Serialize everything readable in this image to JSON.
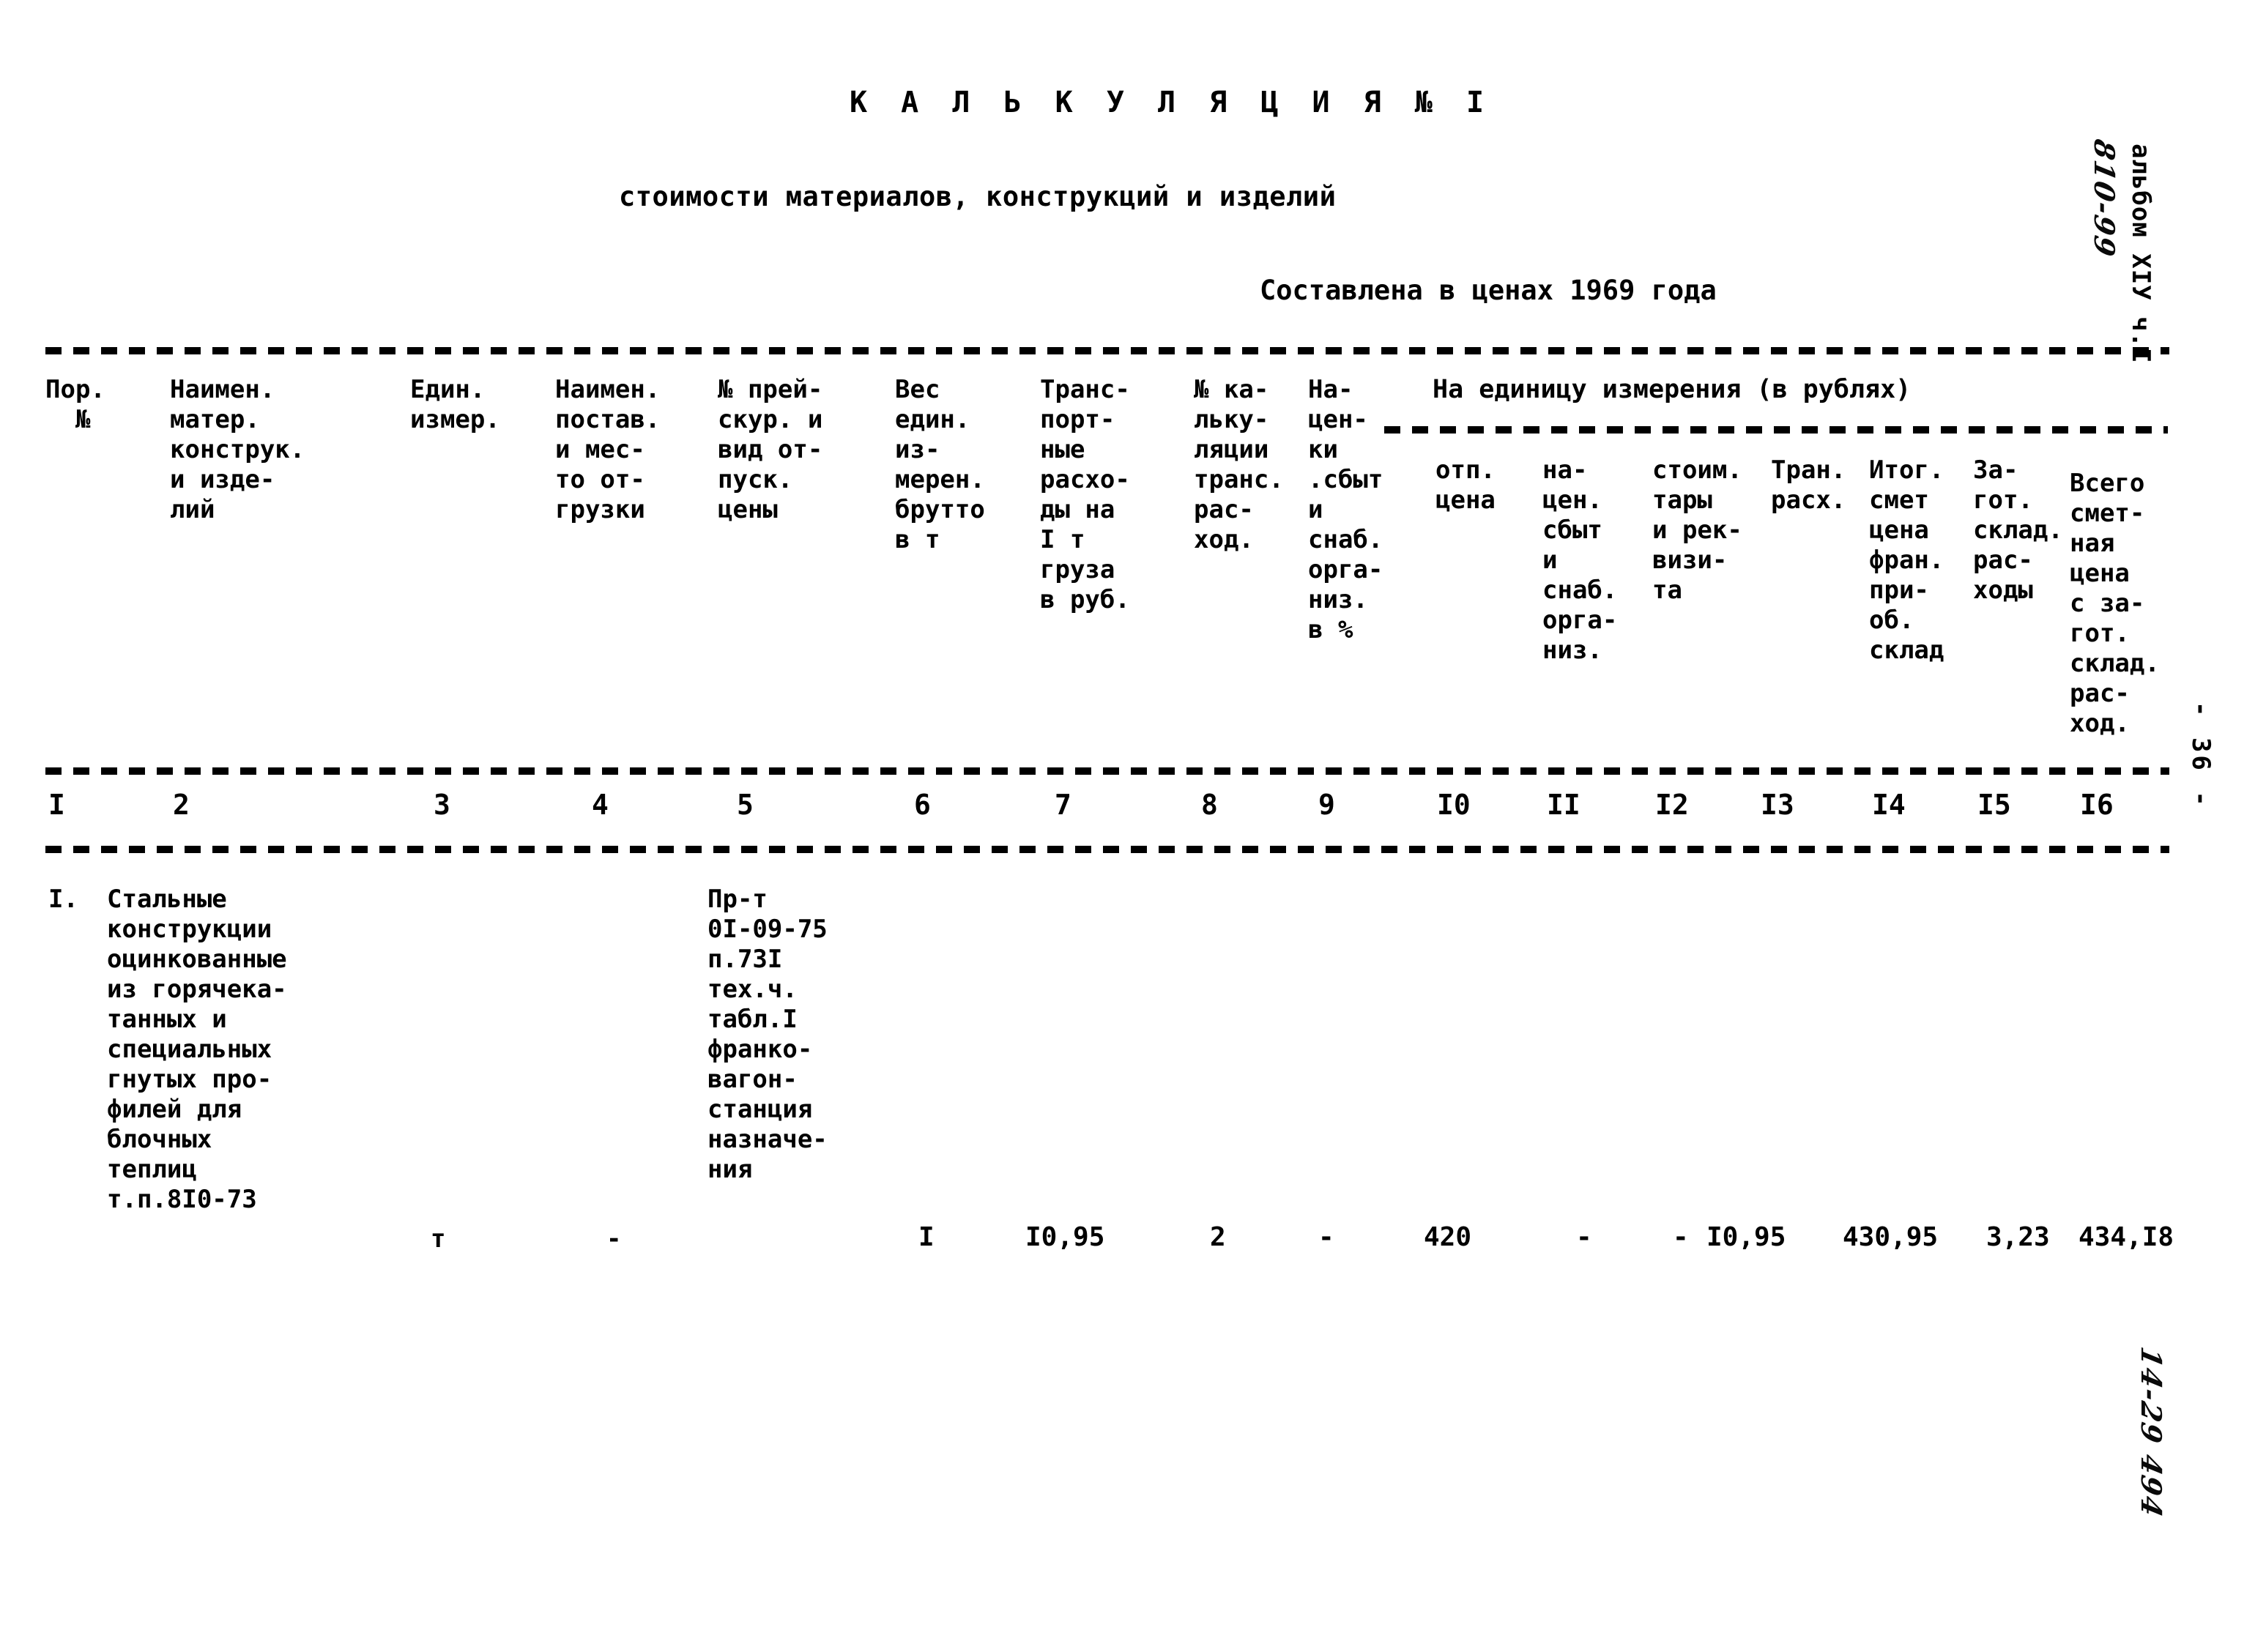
{
  "document": {
    "title": "К А Л Ь К У Л Я Ц И Я № I",
    "subtitle": "стоимости материалов, конструкций и изделий",
    "price_note": "Составлена в ценах 1969 года",
    "album_mark": "альбом XIУ ч.I",
    "page_number": "- 36 -",
    "handwritten_top": "810-99",
    "handwritten_bottom": "14-29 494"
  },
  "table": {
    "group_header": "На единицу измерения (в рублях)",
    "column_numbers": [
      "I",
      "2",
      "3",
      "4",
      "5",
      "6",
      "7",
      "8",
      "9",
      "I0",
      "II",
      "I2",
      "I3",
      "I4",
      "I5",
      "I6"
    ],
    "headers": [
      "Пор.\n  №",
      "Наимен.\nматер.\nконструк.\nи изде-\nлий",
      "Един.\nизмер.",
      "Наимен.\nпостав.\nи мес-\nто от-\nгрузки",
      "№ прей-\nскур. и\nвид от-\nпуск.\nцены",
      "Вес\nедин.\nиз-\nмерен.\nбрутто\nв т",
      "Транс-\nпорт-\nные\nрасхо-\nды на\nI т\nгруза\nв руб.",
      "№ ка-\nльку-\nляции\nтранс.\nрас-\nход.",
      "На-\nцен-\nки\n.сбыт\nи\nснаб.\nорга-\nниз.\nв %",
      "отп.\nцена",
      "на-\nцен.\nсбыт\nи\nснаб.\nорга-\nниз.",
      "стоим.\nтары\nи рек-\nвизи-\nта",
      "Тран.\nрасх.",
      "Итог.\nсмет\nцена\nфран.\nпри-\nоб.\nсклад",
      "За-\nгот.\nсклад.\nрас-\nходы",
      "Всего\nсмет-\nная\nцена\nс за-\nгот.\nсклад.\nрас-\nход."
    ],
    "row": {
      "pos_number": "I.",
      "material_name": "Стальные\nконструкции\nоцинкованные\nиз горячека-\nтанных и\nспециальных\nгнутых про-\nфилей для\nблочных\nтеплиц\nт.п.8I0-73",
      "unit": "т",
      "supplier": "-",
      "price_list": "Пр-т\n0I-09-75\nп.73I\nтех.ч.\nтабл.I\nфранко-\nвагон-\nстанция\nназначе-\nния",
      "weight_brutto": "I",
      "transport_costs": "I0,95",
      "calc_number": "2",
      "markup_pct": "-",
      "release_price": "420",
      "markup_sale": "-",
      "packaging_cost": "-",
      "transport_exp": "I0,95",
      "total_price": "430,95",
      "procurement": "3,23",
      "grand_total": "434,I8"
    }
  }
}
